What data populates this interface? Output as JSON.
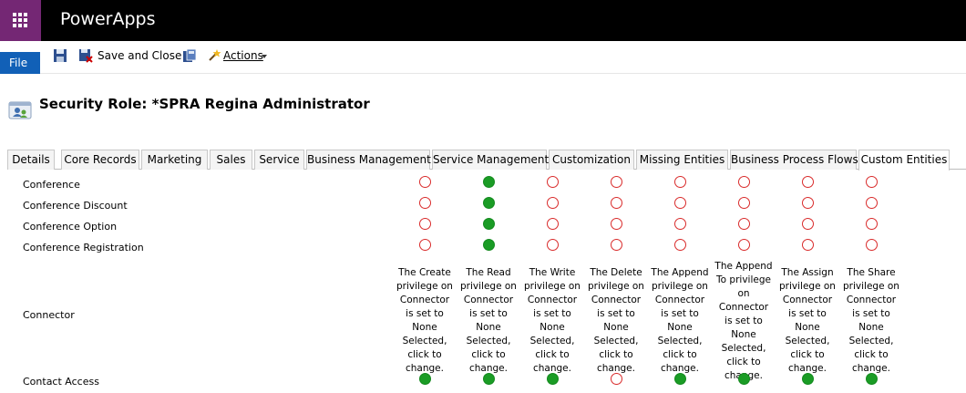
{
  "app": {
    "name": "PowerApps"
  },
  "commands": {
    "file": "File",
    "save_and_close": "Save and Close",
    "actions": "Actions"
  },
  "icons": [
    "waffle-icon",
    "save-icon",
    "save-and-close-icon",
    "copy-role-icon",
    "actions-icon",
    "security-role-icon",
    "privilege-none-icon",
    "privilege-organization-icon"
  ],
  "colors": {
    "waffle": "#742774",
    "file_button": "#1160b7",
    "none": "#d92b2b",
    "organization": "#1a9c25"
  },
  "page": {
    "title": "Security Role: *SPRA Regina Administrator"
  },
  "tabs": [
    {
      "label": "Details",
      "active": false
    },
    {
      "label": "Core Records",
      "active": false
    },
    {
      "label": "Marketing",
      "active": false
    },
    {
      "label": "Sales",
      "active": false
    },
    {
      "label": "Service",
      "active": false
    },
    {
      "label": "Business Management",
      "active": false
    },
    {
      "label": "Service Management",
      "active": false
    },
    {
      "label": "Customization",
      "active": false
    },
    {
      "label": "Missing Entities",
      "active": false
    },
    {
      "label": "Business Process Flows",
      "active": false
    },
    {
      "label": "Custom Entities",
      "active": true
    }
  ],
  "rows": [
    {
      "entity": "Conference",
      "privileges": [
        "none",
        "org",
        "none",
        "none",
        "none",
        "none",
        "none",
        "none"
      ]
    },
    {
      "entity": "Conference Discount",
      "privileges": [
        "none",
        "org",
        "none",
        "none",
        "none",
        "none",
        "none",
        "none"
      ]
    },
    {
      "entity": "Conference Option",
      "privileges": [
        "none",
        "org",
        "none",
        "none",
        "none",
        "none",
        "none",
        "none"
      ]
    },
    {
      "entity": "Conference Registration",
      "privileges": [
        "none",
        "org",
        "none",
        "none",
        "none",
        "none",
        "none",
        "none"
      ]
    },
    {
      "entity": "Connector",
      "privileges_text": [
        "The Create privilege on Connector is set to None Selected, click to change.",
        "The Read privilege on Connector is set to None Selected, click to change.",
        "The Write privilege on Connector is set to None Selected, click to change.",
        "The Delete privilege on Connector is set to None Selected, click to change.",
        "The Append privilege on Connector is set to None Selected, click to change.",
        "The Append To privilege on Connector is set to None Selected, click to change.",
        "The Assign privilege on Connector is set to None Selected, click to change.",
        "The Share privilege on Connector is set to None Selected, click to change."
      ]
    },
    {
      "entity": "Contact Access",
      "privileges": [
        "org",
        "org",
        "org",
        "none",
        "org",
        "org",
        "org",
        "org"
      ]
    }
  ]
}
